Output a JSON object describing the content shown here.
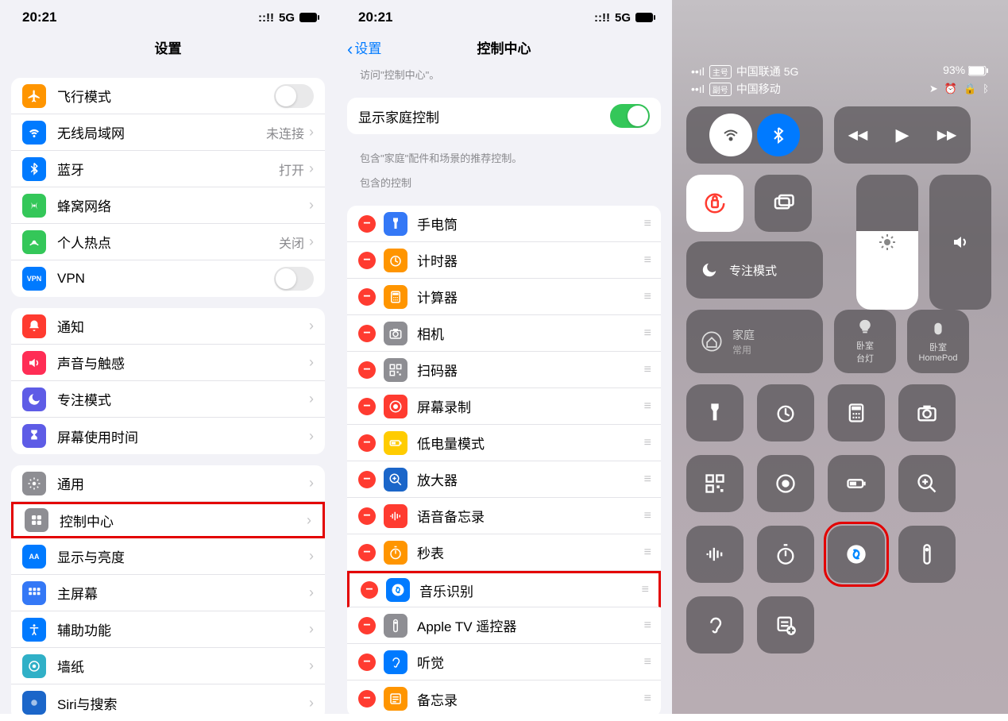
{
  "col1": {
    "status_time": "20:21",
    "status_net": "5G",
    "title": "设置",
    "g1": [
      {
        "icon": "airplane-icon",
        "bg": "orange",
        "label": "飞行模式",
        "type": "toggle",
        "on": false
      },
      {
        "icon": "wifi-icon",
        "bg": "blue",
        "label": "无线局域网",
        "detail": "未连接",
        "chev": true
      },
      {
        "icon": "bluetooth-icon",
        "bg": "blue",
        "label": "蓝牙",
        "detail": "打开",
        "chev": true
      },
      {
        "icon": "cellular-icon",
        "bg": "green",
        "label": "蜂窝网络",
        "chev": true
      },
      {
        "icon": "hotspot-icon",
        "bg": "green",
        "label": "个人热点",
        "detail": "关闭",
        "chev": true
      },
      {
        "icon": "vpn-icon",
        "bg": "blue",
        "label": "VPN",
        "type": "toggle",
        "on": false,
        "text_icon": "VPN"
      }
    ],
    "g2": [
      {
        "icon": "bell-icon",
        "bg": "red",
        "label": "通知",
        "chev": true
      },
      {
        "icon": "speaker-icon",
        "bg": "pink",
        "label": "声音与触感",
        "chev": true
      },
      {
        "icon": "moon-icon",
        "bg": "indigo",
        "label": "专注模式",
        "chev": true
      },
      {
        "icon": "hourglass-icon",
        "bg": "indigo",
        "label": "屏幕使用时间",
        "chev": true
      }
    ],
    "g3": [
      {
        "icon": "gear-icon",
        "bg": "gray",
        "label": "通用",
        "chev": true
      },
      {
        "icon": "control-icon",
        "bg": "gray",
        "label": "控制中心",
        "chev": true,
        "highlight": true
      },
      {
        "icon": "aa-icon",
        "bg": "blue",
        "label": "显示与亮度",
        "chev": true,
        "text_icon": "AA"
      },
      {
        "icon": "apps-icon",
        "bg": "darkblue",
        "label": "主屏幕",
        "chev": true
      },
      {
        "icon": "access-icon",
        "bg": "blue",
        "label": "辅助功能",
        "chev": true
      },
      {
        "icon": "wallpaper-icon",
        "bg": "teal",
        "label": "墙纸",
        "chev": true
      },
      {
        "icon": "siri-icon",
        "bg": "navy",
        "label": "Siri与搜索",
        "chev": true
      }
    ]
  },
  "col2": {
    "status_time": "20:21",
    "status_net": "5G",
    "back": "设置",
    "title": "控制中心",
    "subtitle_top": "访问\"控制中心\"。",
    "home_row_label": "显示家庭控制",
    "home_toggle": true,
    "home_footer": "包含\"家庭\"配件和场景的推荐控制。",
    "section": "包含的控制",
    "items": [
      {
        "bg": "darkblue",
        "label": "手电筒",
        "icon": "flashlight-icon"
      },
      {
        "bg": "orange",
        "label": "计时器",
        "icon": "timer-icon"
      },
      {
        "bg": "orange",
        "label": "计算器",
        "icon": "calc-icon"
      },
      {
        "bg": "gray",
        "label": "相机",
        "icon": "camera-icon"
      },
      {
        "bg": "gray",
        "label": "扫码器",
        "icon": "qr-icon"
      },
      {
        "bg": "red",
        "label": "屏幕录制",
        "icon": "record-icon"
      },
      {
        "bg": "yellow",
        "label": "低电量模式",
        "icon": "battery-icon"
      },
      {
        "bg": "navy",
        "label": "放大器",
        "icon": "magnify-icon"
      },
      {
        "bg": "red",
        "label": "语音备忘录",
        "icon": "wave-icon"
      },
      {
        "bg": "orange",
        "label": "秒表",
        "icon": "stopwatch-icon"
      },
      {
        "bg": "blue",
        "label": "音乐识别",
        "icon": "shazam-icon",
        "highlight": true
      },
      {
        "bg": "gray",
        "label": "Apple TV 遥控器",
        "icon": "remote-icon"
      },
      {
        "bg": "blue",
        "label": "听觉",
        "icon": "ear-icon"
      },
      {
        "bg": "orange",
        "label": "备忘录",
        "icon": "notes-icon"
      }
    ]
  },
  "col3": {
    "carrier1": "中国联通 5G",
    "carrier1_badge": "主号",
    "carrier2": "中国移动",
    "carrier2_badge": "副号",
    "battery": "93%",
    "focus_label": "专注模式",
    "home_label": "家庭",
    "home_sub": "常用",
    "mini1_label": "卧室\n台灯",
    "mini2_label": "卧室\nHomePod",
    "grid_icons": [
      "flashlight-icon",
      "timer-icon",
      "calc-icon",
      "camera-icon",
      "qr-icon",
      "record-icon",
      "battery-icon",
      "magnify-icon",
      "wave-icon",
      "stopwatch-icon",
      "shazam-icon",
      "remote-icon",
      "ear-icon",
      "notes-add-icon"
    ],
    "highlight_index": 10
  }
}
